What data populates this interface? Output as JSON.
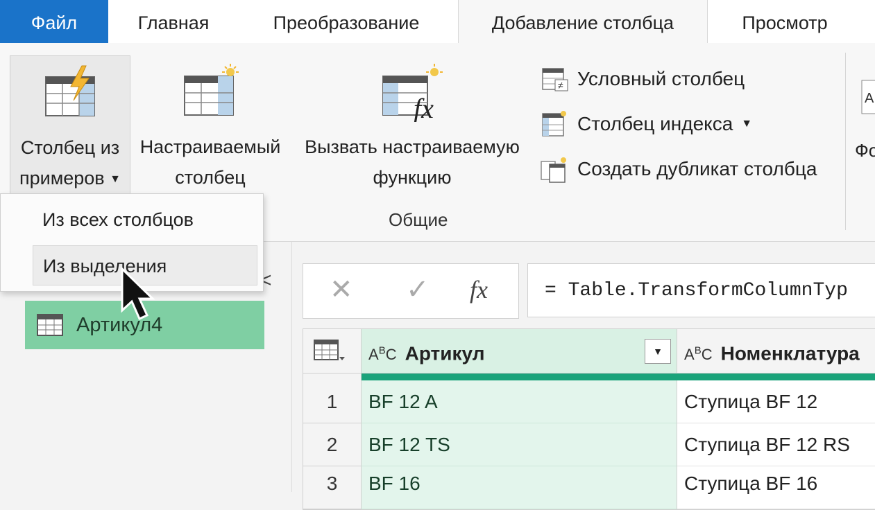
{
  "tabs": {
    "file": "Файл",
    "home": "Главная",
    "transform": "Преобразование",
    "add_column": "Добавление столбца",
    "view": "Просмотр"
  },
  "ribbon": {
    "column_from_examples": {
      "line1": "Столбец из",
      "line2": "примеров"
    },
    "custom_column": {
      "line1": "Настраиваемый",
      "line2": "столбец"
    },
    "invoke_function": {
      "line1": "Вызвать настраиваемую",
      "line2": "функцию"
    },
    "conditional_column": "Условный столбец",
    "index_column": "Столбец индекса",
    "duplicate_column": "Создать дубликат столбца",
    "group_general": "Общие",
    "cut_label": "Фо"
  },
  "dropdown": {
    "items": [
      "Из всех столбцов",
      "Из выделения"
    ]
  },
  "queries": {
    "collapse_glyph": "<",
    "items": [
      {
        "name": "Артикул4"
      }
    ]
  },
  "formula_bar": {
    "cancel": "✕",
    "confirm": "✓",
    "fx": "fx",
    "formula": "= Table.TransformColumnTyp"
  },
  "grid": {
    "columns": [
      {
        "type": "ABC",
        "name": "Артикул"
      },
      {
        "type": "ABC",
        "name": "Номенклатура"
      }
    ],
    "rows": [
      {
        "num": "1",
        "c1": "BF 12 A",
        "c2": "Ступица BF 12"
      },
      {
        "num": "2",
        "c1": "BF 12 TS",
        "c2": "Ступица BF 12 RS"
      },
      {
        "num": "3",
        "c1": "BF 16",
        "c2": "Ступица BF 16"
      }
    ]
  },
  "colors": {
    "accent": "#1a73c9",
    "selected_query": "#7fcfa3",
    "selected_column": "#e3f5ec",
    "column_bar": "#1aa37a"
  }
}
